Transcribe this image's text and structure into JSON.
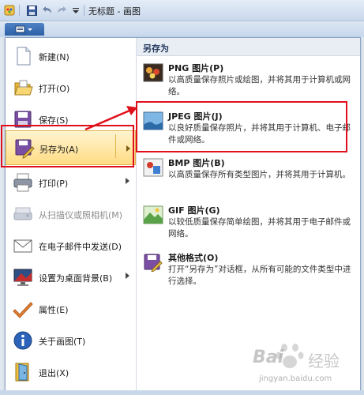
{
  "window": {
    "title": "无标题 - 画图"
  },
  "menu": {
    "items": [
      {
        "label": "新建(N)"
      },
      {
        "label": "打开(O)"
      },
      {
        "label": "保存(S)"
      },
      {
        "label": "另存为(A)"
      },
      {
        "label": "打印(P)"
      },
      {
        "label": "从扫描仪或照相机(M)"
      },
      {
        "label": "在电子邮件中发送(D)"
      },
      {
        "label": "设置为桌面背景(B)"
      },
      {
        "label": "属性(E)"
      },
      {
        "label": "关于画图(T)"
      },
      {
        "label": "退出(X)"
      }
    ]
  },
  "submenu": {
    "header": "另存为",
    "items": [
      {
        "title": "PNG 图片(P)",
        "desc": "以高质量保存照片或绘图，并将其用于计算机或网络。"
      },
      {
        "title": "JPEG 图片(J)",
        "desc": "以良好质量保存照片，并将其用于计算机、电子邮件或网络。"
      },
      {
        "title": "BMP 图片(B)",
        "desc": "以高质量保存所有类型图片，并将其用于计算机。"
      },
      {
        "title": "GIF 图片(G)",
        "desc": "以较低质量保存简单绘图，并将其用于电子邮件或网络。"
      },
      {
        "title": "其他格式(O)",
        "desc": "打开“另存为”对话框，从所有可能的文件类型中进行选择。"
      }
    ]
  },
  "watermark": {
    "line1": "Bai",
    "line2": "经验",
    "url": "jingyan.baidu.com"
  },
  "colors": {
    "highlight": "#ffdc84",
    "annotation": "#e0101a",
    "accent": "#2c5fa5"
  }
}
